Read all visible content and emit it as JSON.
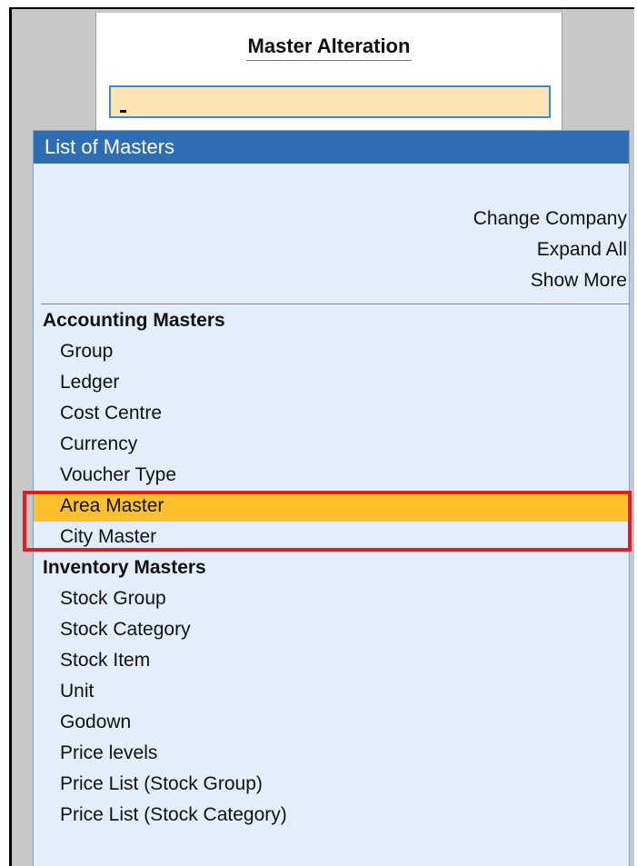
{
  "alteration": {
    "title": "Master Alteration",
    "input_value": ""
  },
  "list": {
    "header": "List of Masters",
    "right_links": [
      "Change Company",
      "Expand All",
      "Show More"
    ],
    "sections": [
      {
        "label": "Accounting Masters",
        "items": [
          "Group",
          "Ledger",
          "Cost Centre",
          "Currency",
          "Voucher Type",
          "Area Master",
          "City Master"
        ]
      },
      {
        "label": "Inventory Masters",
        "items": [
          "Stock Group",
          "Stock Category",
          "Stock Item",
          "Unit",
          "Godown",
          "Price levels",
          "Price List (Stock Group)",
          "Price List (Stock Category)"
        ]
      }
    ],
    "selected_item": "Area Master"
  },
  "colors": {
    "header_bg": "#2e6db3",
    "list_bg": "#e3eefa",
    "selected_bg": "#fcc02d",
    "input_bg": "#fde4b4",
    "annotation_border": "#e31b23"
  }
}
